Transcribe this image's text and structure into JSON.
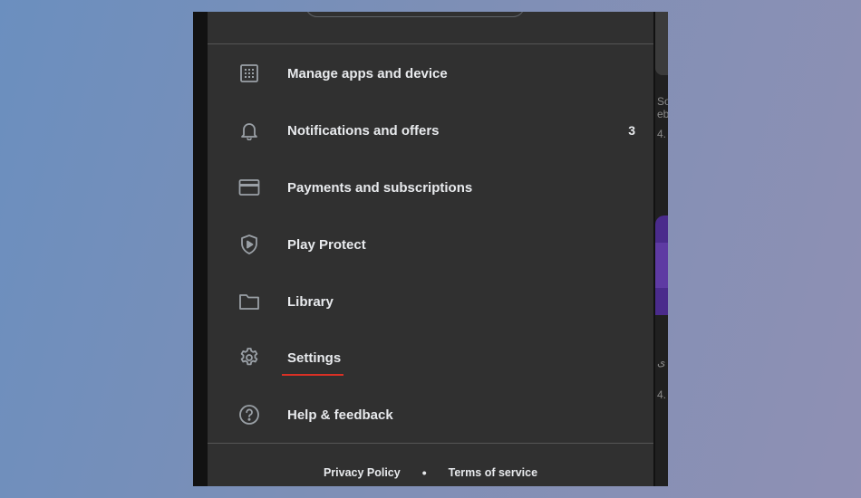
{
  "menu": {
    "items": [
      {
        "label": "Manage apps and device",
        "icon": "grid-icon"
      },
      {
        "label": "Notifications and offers",
        "icon": "bell-icon",
        "badge": "3"
      },
      {
        "label": "Payments and subscriptions",
        "icon": "credit-card-icon"
      },
      {
        "label": "Play Protect",
        "icon": "shield-play-icon"
      },
      {
        "label": "Library",
        "icon": "folder-icon"
      },
      {
        "label": "Settings",
        "icon": "gear-icon",
        "active": true
      },
      {
        "label": "Help & feedback",
        "icon": "help-icon"
      }
    ]
  },
  "footer": {
    "privacy_label": "Privacy Policy",
    "separator": "•",
    "terms_label": "Terms of service"
  },
  "colors": {
    "drawer_bg": "#303030",
    "text": "#e8eaed",
    "icon": "#9aa0a6",
    "active_indicator": "#d93025"
  }
}
